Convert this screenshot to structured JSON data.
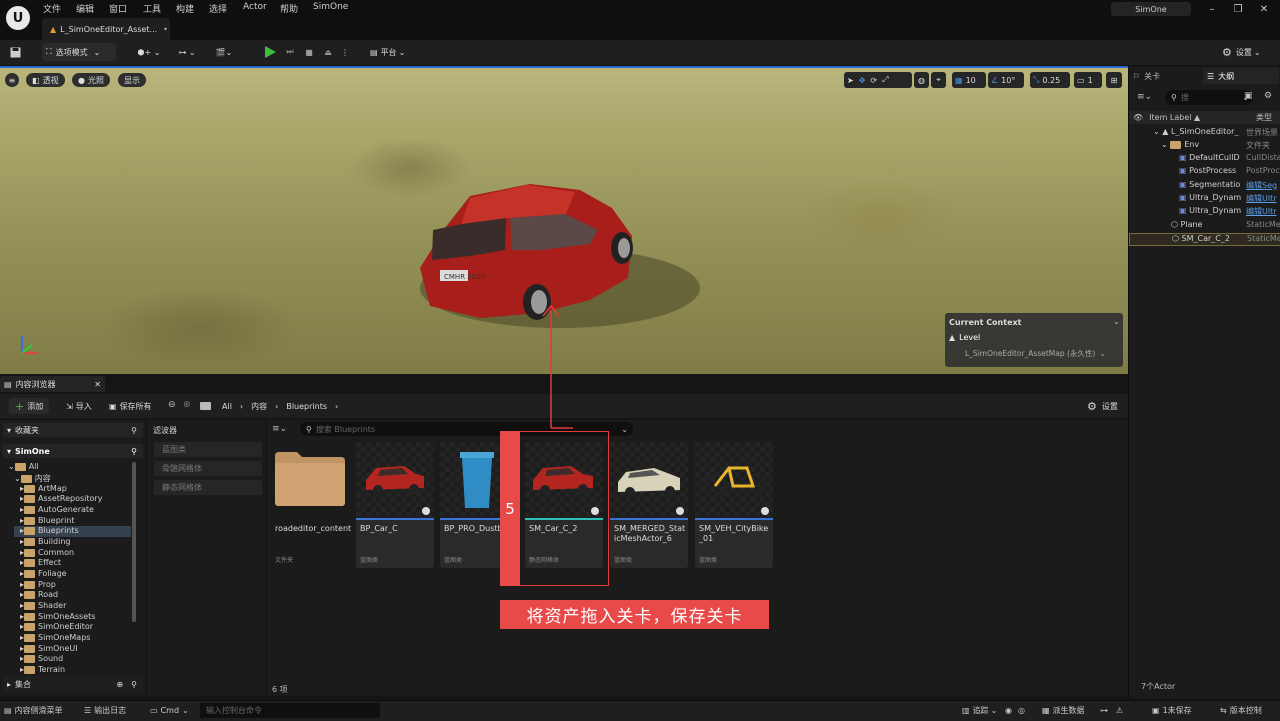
{
  "title_bar": {
    "menu": [
      "文件",
      "编辑",
      "窗口",
      "工具",
      "构建",
      "选择",
      "Actor",
      "帮助",
      "SimOne"
    ],
    "doc_tab": "L_SimOneEditor_Asset...",
    "project_name": "SimOne"
  },
  "toolbar": {
    "mode_label": "选项模式",
    "platform_label": "平台",
    "settings_label": "设置"
  },
  "viewport": {
    "perspective": "透视",
    "lit": "光照",
    "show": "显示",
    "grid_size": "10",
    "rot_snap": "10°",
    "scale_snap": "0.25",
    "cam_speed": "1",
    "plate_text": "CMHR 2020",
    "context_title": "Current Context",
    "context_level": "Level",
    "context_map": "L_SimOneEditor_AssetMap (永久性)"
  },
  "outliner": {
    "tab_level": "关卡",
    "tab_outline": "大纲",
    "search_placeholder": "搜",
    "col_label": "Item Label ▲",
    "col_type": "类型",
    "items": [
      {
        "label": "L_SimOneEditor_",
        "type": "世界场景"
      },
      {
        "label": "Env",
        "type": "文件夹"
      },
      {
        "label": "DefaultCullD",
        "type": "CullDista"
      },
      {
        "label": "PostProcess",
        "type": "PostProc"
      },
      {
        "label": "Segmentatio",
        "type": "编辑Seg"
      },
      {
        "label": "Ultra_Dynam",
        "type": "编辑Ultr"
      },
      {
        "label": "Ultra_Dynam",
        "type": "编辑Ultr"
      },
      {
        "label": "Plane",
        "type": "StaticMe"
      },
      {
        "label": "SM_Car_C_2",
        "type": "StaticMe"
      }
    ],
    "actor_count": "7个Actor"
  },
  "content_browser": {
    "tab_label": "内容浏览器",
    "add": "添加",
    "import": "导入",
    "save_all": "保存所有",
    "breadcrumb": [
      "All",
      "内容",
      "Blueprints"
    ],
    "settings": "设置",
    "favorites": "收藏夹",
    "project": "SimOne",
    "collections": "集合",
    "filter_title": "滤波器",
    "filters": [
      "蓝图类",
      "骨骼网格体",
      "静态网格体"
    ],
    "search_placeholder": "搜索 Blueprints",
    "item_count": "6 项",
    "tree": [
      {
        "label": "All",
        "level": 0
      },
      {
        "label": "内容",
        "level": 1
      },
      {
        "label": "ArtMap",
        "level": 2
      },
      {
        "label": "AssetRepository",
        "level": 2
      },
      {
        "label": "AutoGenerate",
        "level": 2
      },
      {
        "label": "Blueprint",
        "level": 2
      },
      {
        "label": "Blueprints",
        "level": 2
      },
      {
        "label": "Building",
        "level": 2
      },
      {
        "label": "Common",
        "level": 2
      },
      {
        "label": "Effect",
        "level": 2
      },
      {
        "label": "Foliage",
        "level": 2
      },
      {
        "label": "Prop",
        "level": 2
      },
      {
        "label": "Road",
        "level": 2
      },
      {
        "label": "Shader",
        "level": 2
      },
      {
        "label": "SimOneAssets",
        "level": 2
      },
      {
        "label": "SimOneEditor",
        "level": 2
      },
      {
        "label": "SimOneMaps",
        "level": 2
      },
      {
        "label": "SimOneUI",
        "level": 2
      },
      {
        "label": "Sound",
        "level": 2
      },
      {
        "label": "Terrain",
        "level": 2
      }
    ],
    "assets": [
      {
        "name": "roadeditor_content",
        "type": "文件夹"
      },
      {
        "name": "BP_Car_C",
        "type": "蓝图类"
      },
      {
        "name": "BP_PRO_Dustbin",
        "type": "蓝图类"
      },
      {
        "name": "SM_Car_C_2",
        "type": "静态网格体"
      },
      {
        "name": "SM_MERGED_StaticMeshActor_6",
        "type": "蓝图类"
      },
      {
        "name": "SM_VEH_CityBike_01",
        "type": "蓝图类"
      }
    ]
  },
  "status_bar": {
    "drawer": "内容侧滑菜单",
    "output_log": "输出日志",
    "cmd": "Cmd",
    "console_placeholder": "输入控制台命令",
    "trace": "追踪",
    "derived_data": "派生数据",
    "unsaved": "1未保存",
    "source_control": "版本控制"
  },
  "annotation": {
    "step": "5",
    "instruction": "将资产拖入关卡，保存关卡"
  },
  "colors": {
    "accent_blue": "#2c6ad1",
    "annotation_red": "#e84a4a",
    "play_green": "#3dbd3d"
  }
}
